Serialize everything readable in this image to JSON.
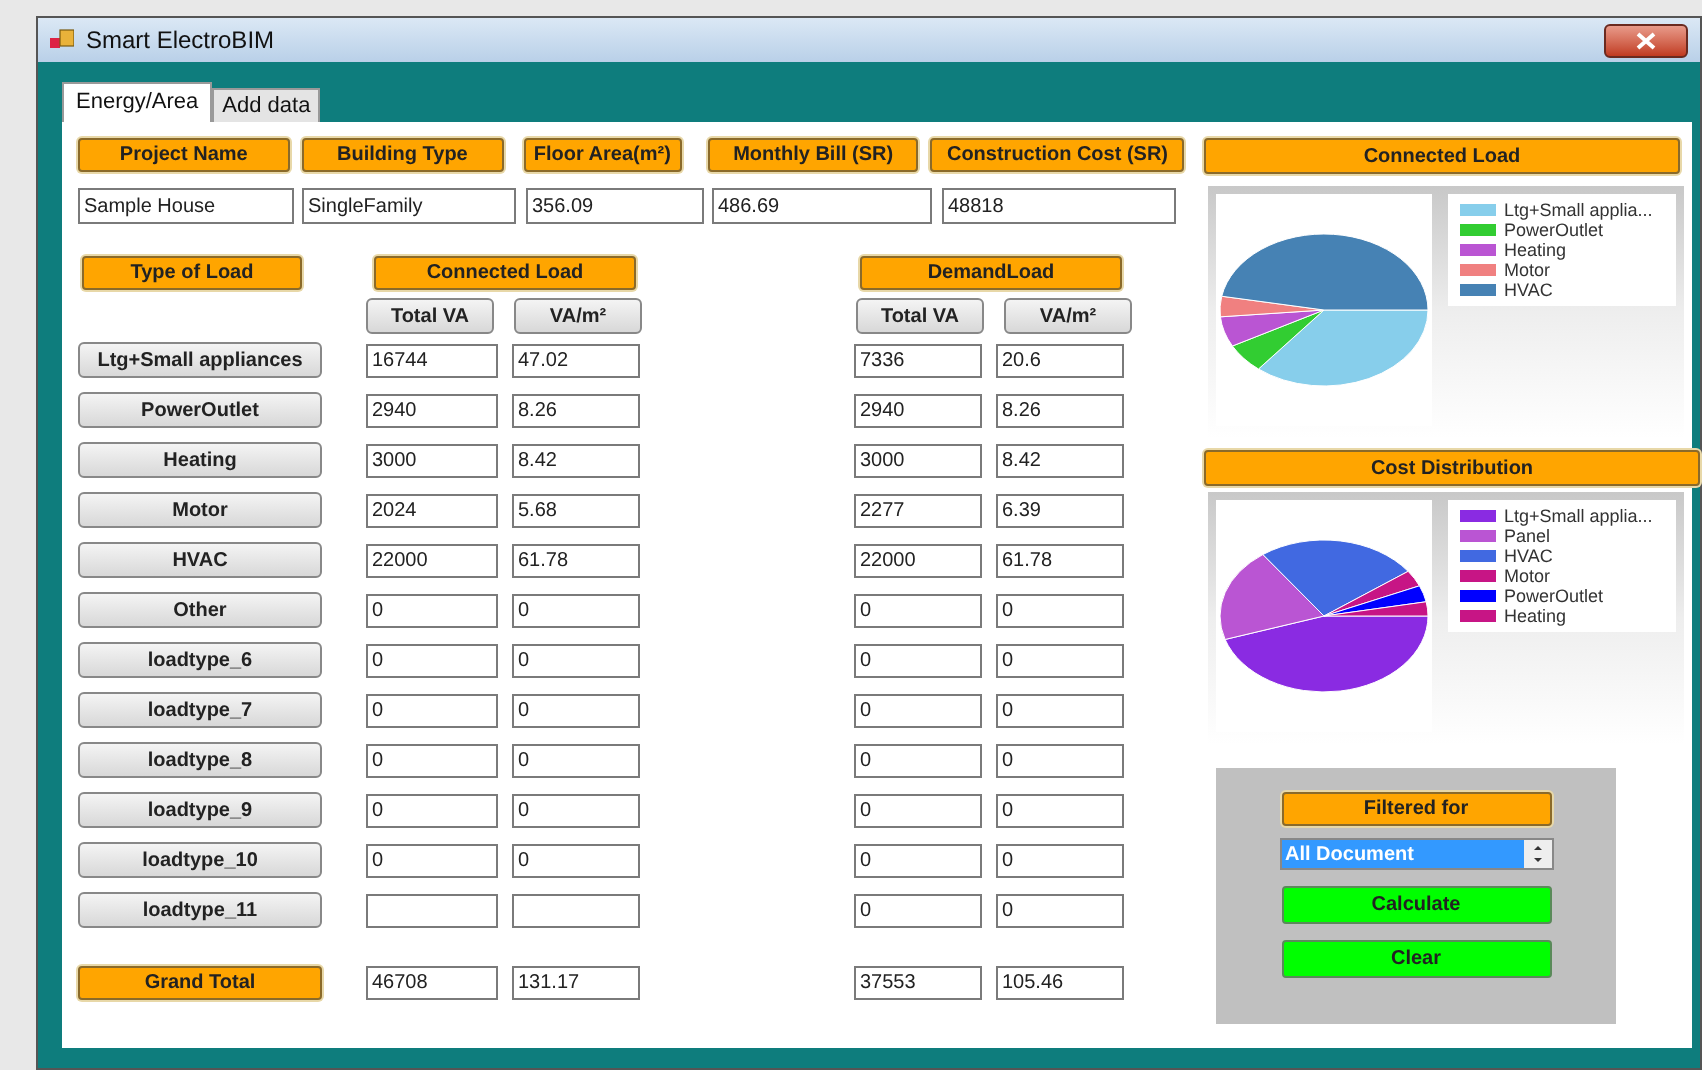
{
  "window": {
    "title": "Smart ElectroBIM"
  },
  "tabs": [
    {
      "label": "Energy/Area",
      "selected": true
    },
    {
      "label": "Add data",
      "selected": false
    }
  ],
  "project_fields": [
    {
      "label": "Project Name",
      "value": "Sample House"
    },
    {
      "label": "Building Type",
      "value": "SingleFamily"
    },
    {
      "label": "Floor Area(m²)",
      "value": "356.09"
    },
    {
      "label": "Monthly Bill (SR)",
      "value": "486.69"
    },
    {
      "label": "Construction  Cost (SR)",
      "value": "48818"
    }
  ],
  "load_table": {
    "type_heading": "Type of Load",
    "connected_heading": "Connected Load",
    "demand_heading": "DemandLoad",
    "subheadings": [
      "Total VA",
      "VA/m²",
      "Total VA",
      "VA/m²"
    ],
    "rows": [
      {
        "name": "Ltg+Small appliances",
        "connected_va": "16744",
        "connected_vam2": "47.02",
        "demand_va": "7336",
        "demand_vam2": "20.6"
      },
      {
        "name": "PowerOutlet",
        "connected_va": "2940",
        "connected_vam2": "8.26",
        "demand_va": "2940",
        "demand_vam2": "8.26"
      },
      {
        "name": "Heating",
        "connected_va": "3000",
        "connected_vam2": "8.42",
        "demand_va": "3000",
        "demand_vam2": "8.42"
      },
      {
        "name": "Motor",
        "connected_va": "2024",
        "connected_vam2": "5.68",
        "demand_va": "2277",
        "demand_vam2": "6.39"
      },
      {
        "name": "HVAC",
        "connected_va": "22000",
        "connected_vam2": "61.78",
        "demand_va": "22000",
        "demand_vam2": "61.78"
      },
      {
        "name": "Other",
        "connected_va": "0",
        "connected_vam2": "0",
        "demand_va": "0",
        "demand_vam2": "0"
      },
      {
        "name": "loadtype_6",
        "connected_va": "0",
        "connected_vam2": "0",
        "demand_va": "0",
        "demand_vam2": "0"
      },
      {
        "name": "loadtype_7",
        "connected_va": "0",
        "connected_vam2": "0",
        "demand_va": "0",
        "demand_vam2": "0"
      },
      {
        "name": "loadtype_8",
        "connected_va": "0",
        "connected_vam2": "0",
        "demand_va": "0",
        "demand_vam2": "0"
      },
      {
        "name": "loadtype_9",
        "connected_va": "0",
        "connected_vam2": "0",
        "demand_va": "0",
        "demand_vam2": "0"
      },
      {
        "name": "loadtype_10",
        "connected_va": "0",
        "connected_vam2": "0",
        "demand_va": "0",
        "demand_vam2": "0"
      },
      {
        "name": "loadtype_11",
        "demand_va": "0",
        "demand_vam2": "0"
      }
    ],
    "total": {
      "label": "Grand Total",
      "connected_va": "46708",
      "connected_vam2": "131.17",
      "demand_va": "37553",
      "demand_vam2": "105.46"
    }
  },
  "connected_load_chart": {
    "title": "Connected Load",
    "legend": [
      {
        "label": "Ltg+Small applia...",
        "color": "#87ceeb"
      },
      {
        "label": "PowerOutlet",
        "color": "#32cd32"
      },
      {
        "label": "Heating",
        "color": "#ba55d3"
      },
      {
        "label": "Motor",
        "color": "#f08080"
      },
      {
        "label": "HVAC",
        "color": "#4682b4"
      }
    ]
  },
  "cost_chart": {
    "title": "Cost Distribution",
    "legend": [
      {
        "label": "Ltg+Small applia...",
        "color": "#8a2be2"
      },
      {
        "label": "Panel",
        "color": "#ba55d3"
      },
      {
        "label": "HVAC",
        "color": "#4169e1"
      },
      {
        "label": "Motor",
        "color": "#c71585"
      },
      {
        "label": "PowerOutlet",
        "color": "#0000ff"
      },
      {
        "label": "Heating",
        "color": "#c71585"
      }
    ]
  },
  "filter_panel": {
    "label": "Filtered for",
    "selection": "All Document",
    "buttons": [
      "Calculate",
      "Clear"
    ]
  }
}
